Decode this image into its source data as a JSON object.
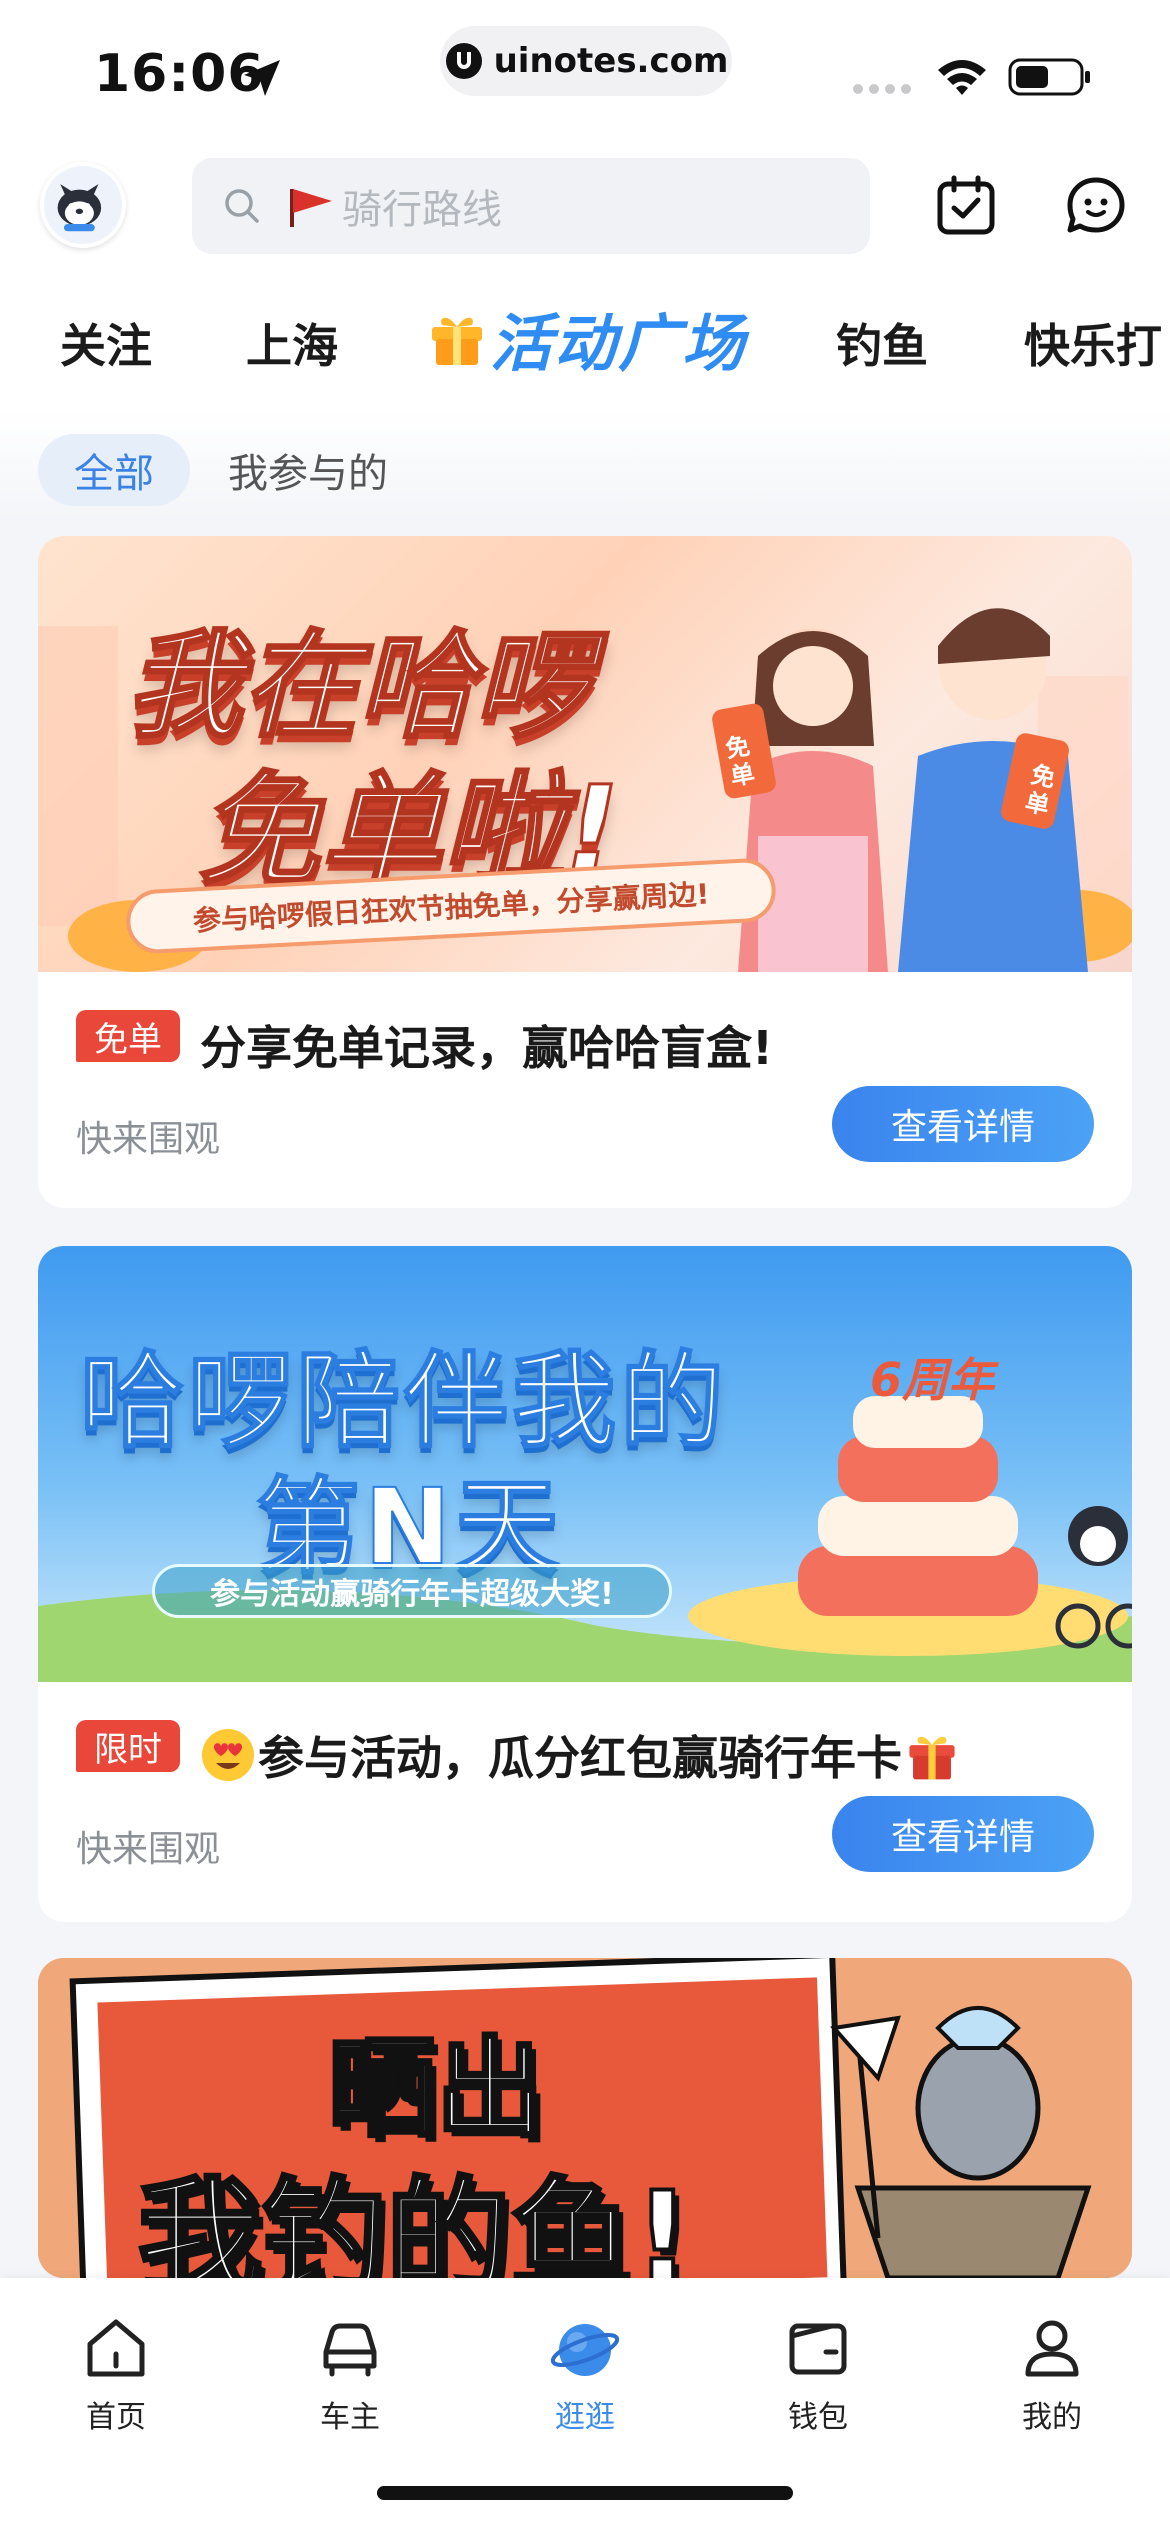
{
  "status_bar": {
    "time": "16:06",
    "url": "uinotes.com"
  },
  "search": {
    "placeholder": "骑行路线"
  },
  "categories": {
    "items": [
      "关注",
      "上海",
      "活动广场",
      "钓鱼",
      "快乐打"
    ],
    "active": "活动广场"
  },
  "sub_tabs": {
    "all": "全部",
    "mine": "我参与的"
  },
  "cards": [
    {
      "banner_line1": "我在哈啰",
      "banner_line2": "免单啦!",
      "banner_ribbon": "参与哈啰假日狂欢节抽免单，分享赢周边!",
      "phone_badge": "免单",
      "tag": "免单",
      "title": "分享免单记录，赢哈哈盲盒!",
      "subtitle": "快来围观",
      "button": "查看详情"
    },
    {
      "banner_line1": "哈啰陪伴我的",
      "banner_line2": "第N天",
      "banner_ribbon": "参与活动赢骑行年卡超级大奖!",
      "banner_badge": "6周年",
      "tag": "限时",
      "title": "参与活动，瓜分红包赢骑行年卡",
      "subtitle": "快来围观",
      "button": "查看详情"
    },
    {
      "banner_line1": "晒出",
      "banner_line2": "我钓的鱼!"
    }
  ],
  "bottom_nav": [
    {
      "label": "首页",
      "icon": "home-icon"
    },
    {
      "label": "车主",
      "icon": "car-icon"
    },
    {
      "label": "逛逛",
      "icon": "planet-icon",
      "active": true
    },
    {
      "label": "钱包",
      "icon": "wallet-icon"
    },
    {
      "label": "我的",
      "icon": "profile-icon"
    }
  ],
  "colors": {
    "accent": "#3b8bea",
    "tag_red": "#e9473a",
    "button_blue": "#3a84ee"
  }
}
